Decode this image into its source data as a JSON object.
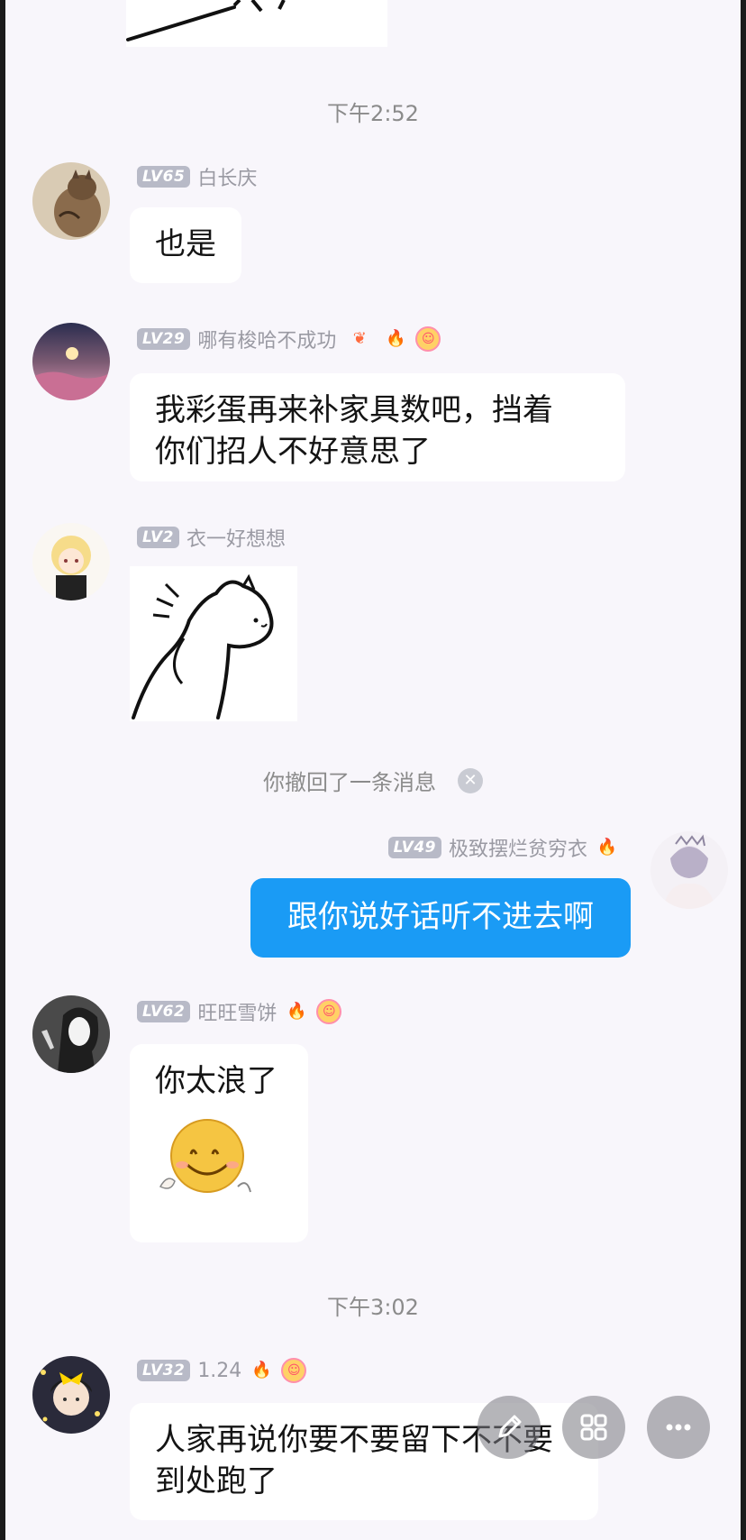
{
  "times": {
    "t1": "下午2:52",
    "t2": "下午3:02"
  },
  "recall": {
    "text": "你撤回了一条消息"
  },
  "messages": [
    {
      "level": "LV65",
      "name": "白长庆",
      "text": "也是"
    },
    {
      "level": "LV29",
      "name": "哪有梭哈不成功",
      "lines": [
        "我彩蛋再来补家具数吧，挡着",
        "你们招人不好意思了"
      ]
    },
    {
      "level": "LV2",
      "name": "衣一好想想"
    },
    {
      "level": "LV49",
      "name": "极致摆烂贫穷衣",
      "text": "跟你说好话听不进去啊"
    },
    {
      "level": "LV62",
      "name": "旺旺雪饼",
      "text": "你太浪了"
    },
    {
      "level": "LV32",
      "name": "1.24",
      "lines": [
        "人家再说你要不要留下不不要",
        "到处跑了"
      ]
    }
  ],
  "icons": {
    "edit": "pencil-icon",
    "apps": "grid-icon",
    "more": "more-icon",
    "recall_close": "close-icon",
    "fire": "fire-icon",
    "smile": "smile-badge-icon",
    "wing": "wing-badge-icon"
  },
  "colors": {
    "self_bubble": "#1a9bf5",
    "level_badge": "#b8bac7",
    "background": "#f8f6fb"
  }
}
